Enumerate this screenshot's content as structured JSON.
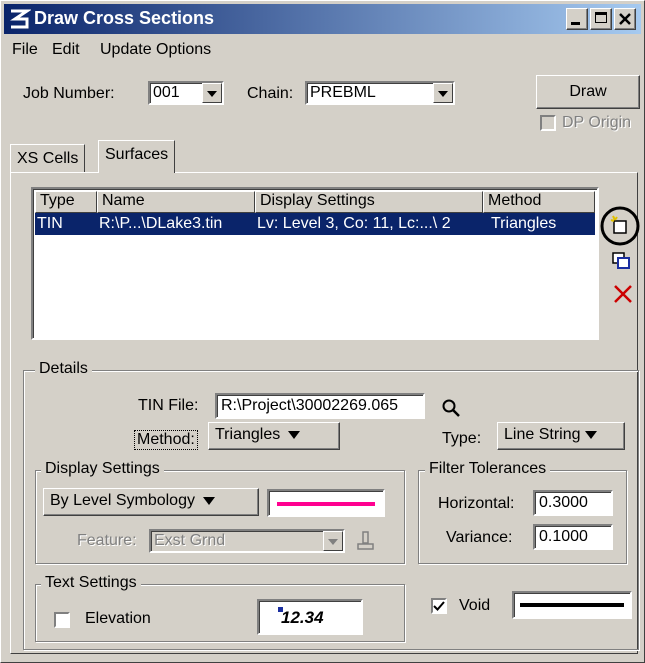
{
  "window": {
    "title": "Draw Cross Sections"
  },
  "menu": [
    "File",
    "Edit",
    "Update Options"
  ],
  "top": {
    "job_label": "Job Number:",
    "job_value": "001",
    "chain_label": "Chain:",
    "chain_value": "PREBML",
    "draw_label": "Draw",
    "dp_origin_label": "DP Origin",
    "dp_origin_checked": false
  },
  "tabs": [
    "XS Cells",
    "Surfaces"
  ],
  "active_tab": "Surfaces",
  "surfaces_table": {
    "columns": [
      "Type",
      "Name",
      "Display Settings",
      "Method"
    ],
    "rows": [
      {
        "type": "TIN",
        "name": "R:\\P...\\DLake3.tin",
        "display": "Lv: Level 3, Co: 11, Lc:...\\ 2",
        "method": "Triangles"
      }
    ]
  },
  "details": {
    "title": "Details",
    "tin_file_label": "TIN File:",
    "tin_file_value": "R:\\Project\\30002269.065",
    "method_label": "Method:",
    "method_value": "Triangles",
    "type_label": "Type:",
    "type_value": "Line String"
  },
  "display_settings": {
    "title": "Display Settings",
    "mode": "By Level Symbology",
    "feature_label": "Feature:",
    "feature_value": "Exst Grnd",
    "line_color": "#ff0090"
  },
  "filter_tolerances": {
    "title": "Filter Tolerances",
    "horizontal_label": "Horizontal:",
    "horizontal_value": "0.3000",
    "variance_label": "Variance:",
    "variance_value": "0.1000"
  },
  "text_settings": {
    "title": "Text Settings",
    "elevation_label": "Elevation",
    "elevation_checked": false,
    "preview_text": "12.34"
  },
  "void": {
    "label": "Void",
    "checked": true
  },
  "colors": {
    "titlebar": "#0a246a",
    "selection": "#0a246a",
    "face": "#d4d0c8",
    "delete": "#cc0000"
  },
  "side_icons": [
    "add-surface-icon",
    "copy-surface-icon",
    "delete-surface-icon"
  ]
}
